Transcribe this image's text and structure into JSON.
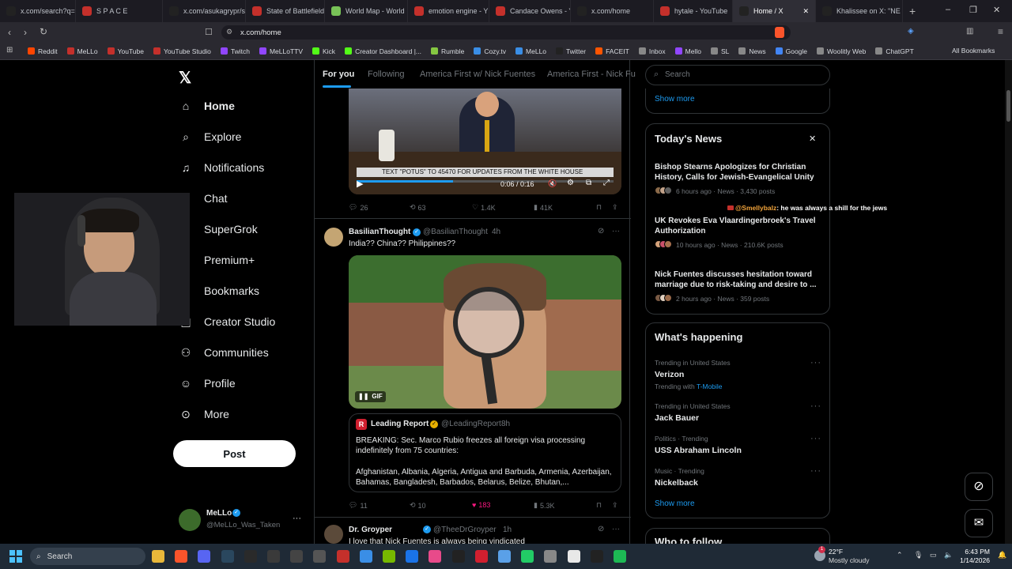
{
  "tabs": [
    {
      "title": "x.com/search?q=re",
      "color": "#222"
    },
    {
      "title": "S P A C E",
      "color": "#c4302b"
    },
    {
      "title": "x.com/asukagrypr/s",
      "color": "#222"
    },
    {
      "title": "State of Battlefield",
      "color": "#c4302b"
    },
    {
      "title": "World Map - World",
      "color": "#78c257"
    },
    {
      "title": "emotion engine - Y",
      "color": "#c4302b"
    },
    {
      "title": "Candace Owens - Y",
      "color": "#c4302b"
    },
    {
      "title": "x.com/home",
      "color": "#222"
    },
    {
      "title": "hytale - YouTube",
      "color": "#c4302b"
    },
    {
      "title": "Home / X",
      "color": "#222"
    },
    {
      "title": "Khalissee on X: \"NE",
      "color": "#222"
    }
  ],
  "address": "x.com/home",
  "bookmarks": [
    {
      "label": "Reddit",
      "color": "#ff4500"
    },
    {
      "label": "MeLLo",
      "color": "#c4302b"
    },
    {
      "label": "YouTube",
      "color": "#c4302b"
    },
    {
      "label": "YouTube Studio",
      "color": "#c4302b"
    },
    {
      "label": "Twitch",
      "color": "#9146ff"
    },
    {
      "label": "MeLLoTTV",
      "color": "#9146ff"
    },
    {
      "label": "Kick",
      "color": "#53fc18"
    },
    {
      "label": "Creator Dashboard |...",
      "color": "#53fc18"
    },
    {
      "label": "Rumble",
      "color": "#85c742"
    },
    {
      "label": "Cozy.tv",
      "color": "#3a8ee6"
    },
    {
      "label": "MeLLo",
      "color": "#3a8ee6"
    },
    {
      "label": "Twitter",
      "color": "#222"
    },
    {
      "label": "FACEIT",
      "color": "#ff5500"
    },
    {
      "label": "Inbox",
      "color": "#888"
    },
    {
      "label": "Mello",
      "color": "#9146ff"
    },
    {
      "label": "SL",
      "color": "#888"
    },
    {
      "label": "News",
      "color": "#888"
    },
    {
      "label": "Google",
      "color": "#4285f4"
    },
    {
      "label": "Woolitly Web",
      "color": "#888"
    },
    {
      "label": "ChatGPT",
      "color": "#888"
    }
  ],
  "all_bookmarks": "All Bookmarks",
  "nav": {
    "home": "Home",
    "explore": "Explore",
    "notifications": "Notifications",
    "chat": "Chat",
    "supergrok": "SuperGrok",
    "premium": "Premium+",
    "bookmarks": "Bookmarks",
    "creator": "Creator Studio",
    "communities": "Communities",
    "profile": "Profile",
    "more": "More",
    "post": "Post"
  },
  "account": {
    "name": "MeLLo",
    "handle": "@MeLLo_Was_Taken"
  },
  "feed_tabs": [
    "For you",
    "Following",
    "America First w/ Nick Fuentes",
    "America First - Nick Fu"
  ],
  "tweet1": {
    "caption": "TEXT \"POTUS\" TO 45470 FOR UPDATES FROM THE WHITE HOUSE",
    "time": "0:06 / 0:16",
    "replies": "26",
    "reposts": "63",
    "likes": "1.4K",
    "views": "41K"
  },
  "tweet2": {
    "name": "BasilianThought",
    "handle": "@BasilianThought",
    "time": "4h",
    "text": "India?? China?? Philippines??",
    "gif": "GIF",
    "quote": {
      "name": "Leading Report",
      "handle": "@LeadingReport",
      "time": "8h",
      "line1": "BREAKING: Sec. Marco Rubio freezes all foreign visa processing indefinitely from 75 countries:",
      "line2": "Afghanistan, Albania, Algeria, Antigua and Barbuda, Armenia, Azerbaijan, Bahamas, Bangladesh, Barbados, Belarus, Belize, Bhutan,..."
    },
    "replies": "11",
    "reposts": "10",
    "likes": "183",
    "views": "5.3K"
  },
  "tweet3": {
    "name": "Dr. Groyper",
    "handle": "@TheeDrGroyper",
    "time": "1h",
    "text": "I love that Nick Fuentes is always being vindicated"
  },
  "search_placeholder": "Search",
  "show_more_top": "Show more",
  "news": {
    "title": "Today's News",
    "items": [
      {
        "title": "Bishop Stearns Apologizes for Christian History, Calls for Jewish-Evangelical Unity",
        "meta": "6 hours ago · News · 3,430 posts"
      },
      {
        "title": "UK Revokes Eva Vlaardingerbroek's Travel Authorization",
        "meta": "10 hours ago · News · 210.6K posts"
      },
      {
        "title": "Nick Fuentes discusses hesitation toward marriage due to risk-taking and desire to ...",
        "meta": "2 hours ago · News · 359 posts"
      }
    ]
  },
  "chat_overlay": {
    "user": "@Smellybalz",
    "text": ": he was always a shill for the jews"
  },
  "happening": {
    "title": "What's happening",
    "items": [
      {
        "sub": "Trending in United States",
        "topic": "Verizon",
        "extra_prefix": "Trending with",
        "extra_link": "T-Mobile"
      },
      {
        "sub": "Trending in United States",
        "topic": "Jack Bauer"
      },
      {
        "sub": "Politics · Trending",
        "topic": "USS Abraham Lincoln"
      },
      {
        "sub": "Music · Trending",
        "topic": "Nickelback"
      }
    ],
    "show_more": "Show more"
  },
  "who_to_follow": "Who to follow",
  "taskbar": {
    "search": "Search",
    "weather_temp": "22°F",
    "weather_desc": "Mostly cloudy",
    "time": "6:43 PM",
    "date": "1/14/2026",
    "badge": "1"
  },
  "accent": "#1d9bf0",
  "like_color": "#f91880"
}
